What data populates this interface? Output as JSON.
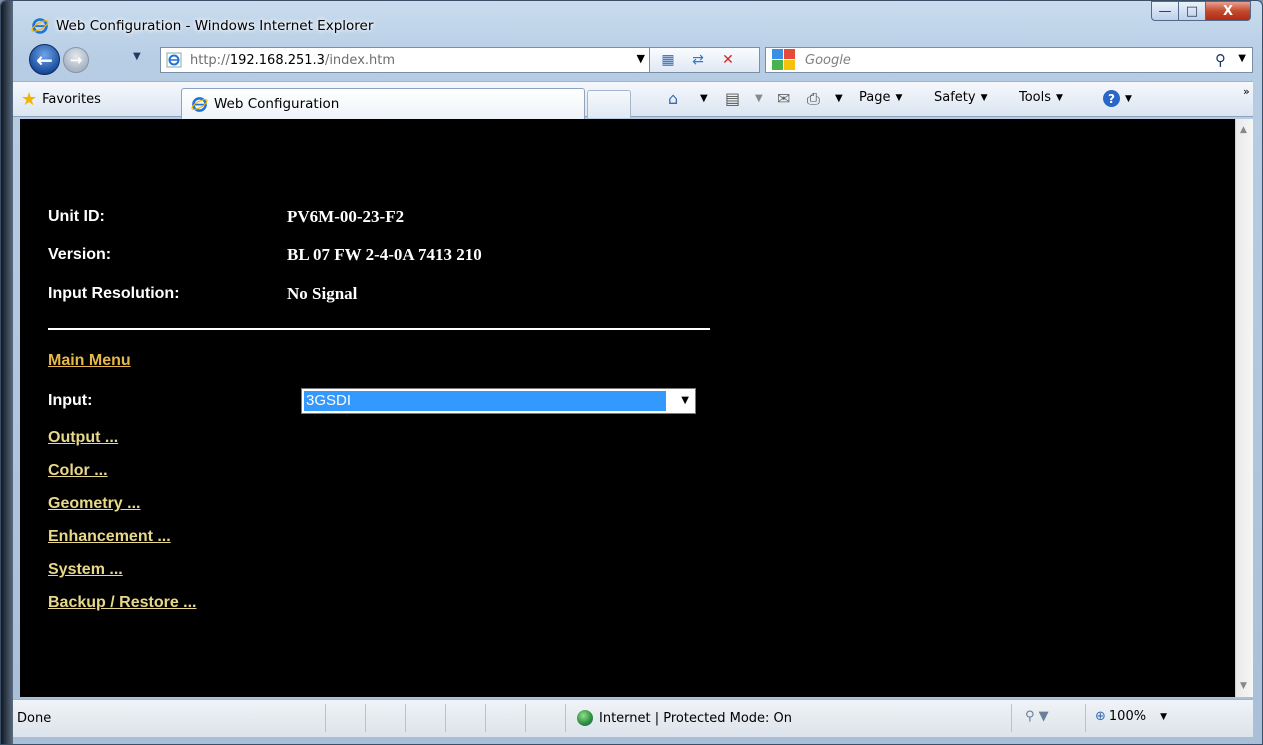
{
  "window": {
    "title": "Web Configuration - Windows Internet Explorer",
    "min": "—",
    "max": "□",
    "close": "X"
  },
  "address": {
    "url_prefix": "http://",
    "url_host": "192.168.251.3",
    "url_path": "/index.htm"
  },
  "search": {
    "placeholder": "Google"
  },
  "toolbar": {
    "favorites": "Favorites",
    "tab_title": "Web Configuration",
    "page": "Page",
    "safety": "Safety",
    "tools": "Tools"
  },
  "info": {
    "unit_id_label": "Unit ID:",
    "unit_id_value": "PV6M-00-23-F2",
    "version_label": "Version:",
    "version_value": "BL 07 FW 2-4-0A 7413 210",
    "resolution_label": "Input Resolution:",
    "resolution_value": "No Signal"
  },
  "menu": {
    "main_menu": "Main Menu",
    "input_label": "Input:",
    "input_selected": "3GSDI",
    "links": [
      "Output ...",
      "Color ...",
      "Geometry ...",
      "Enhancement ...",
      "System ...",
      "Backup / Restore ..."
    ]
  },
  "status": {
    "text": "Done",
    "zone": "Internet | Protected Mode: On",
    "zoom": "100%"
  },
  "colors": {
    "content_bg": "#000000",
    "main_menu_link": "#e6b84a",
    "menu_link": "#e8d88a",
    "select_highlight": "#3399ff"
  }
}
